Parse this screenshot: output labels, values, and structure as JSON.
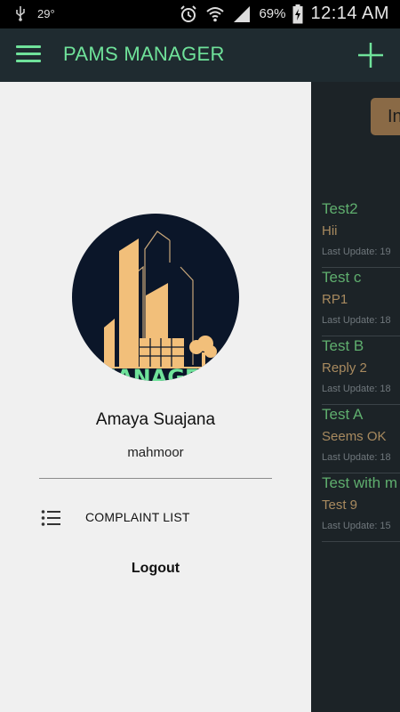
{
  "status_bar": {
    "temperature": "29°",
    "battery": "69%",
    "time": "12:14 AM"
  },
  "app_bar": {
    "title": "PAMS MANAGER"
  },
  "background": {
    "filter_button_label": "In",
    "items": [
      {
        "title": "Test2",
        "reply": "Hii",
        "date": "Last Update: 19"
      },
      {
        "title": "Test c",
        "reply": "RP1",
        "date": "Last Update: 18"
      },
      {
        "title": "Test B",
        "reply": "Reply 2",
        "date": "Last Update: 18"
      },
      {
        "title": "Test A",
        "reply": "Seems OK",
        "date": "Last Update: 18"
      },
      {
        "title": "Test with m",
        "reply": "Test 9",
        "date": "Last Update: 15"
      }
    ]
  },
  "drawer": {
    "avatar_text": "MANAGER",
    "user_name": "Amaya Suajana",
    "user_sub": "mahmoor",
    "nav_items": [
      {
        "label": "COMPLAINT LIST",
        "icon": "list-icon"
      }
    ],
    "logout_label": "Logout"
  },
  "colors": {
    "accent": "#6fe29a",
    "app_bar": "#1f2b30",
    "drawer_bg": "#f0f0f0",
    "item_title": "#5fae6e",
    "item_reply": "#a88a5f"
  }
}
